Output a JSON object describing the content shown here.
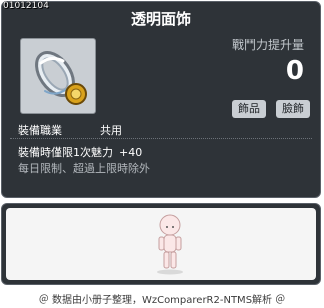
{
  "item": {
    "id": "01012104",
    "name": "透明面饰",
    "icon": "transparent-face-accessory-icon"
  },
  "stats": {
    "label": "戰鬥力提升量",
    "value": "0"
  },
  "tags": [
    "飾品",
    "臉飾"
  ],
  "job": {
    "label": "裝備職業",
    "value": "共用"
  },
  "description": {
    "line1": "裝備時僅限1次魅力",
    "line1_bonus": "+40",
    "line2": "每日限制、超過上限時除外"
  },
  "preview": {
    "character": "character-preview-icon"
  },
  "footer": {
    "credit": "＠ 数据由小册子整理，WzComparerR2-NTMS解析 ＠"
  },
  "colors": {
    "panel_bg": "#2e3338",
    "panel_border": "#5a6068",
    "tag_bg": "#c9ced3",
    "ring_gold": "#d9a21c"
  }
}
